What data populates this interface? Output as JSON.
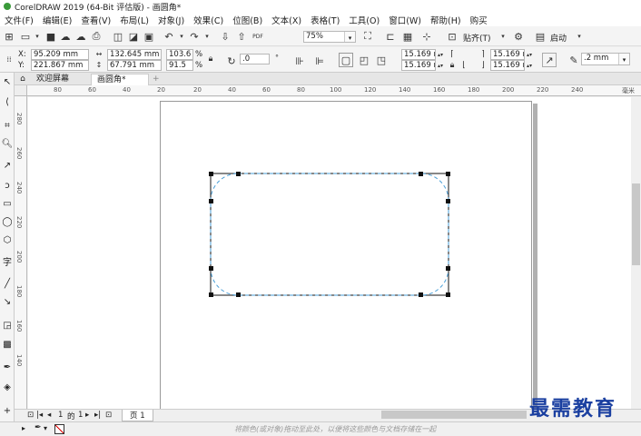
{
  "window": {
    "title": "CorelDRAW 2019 (64-Bit 评估版) - 画圆角*"
  },
  "menu": [
    "文件(F)",
    "编辑(E)",
    "查看(V)",
    "布局(L)",
    "对象(J)",
    "效果(C)",
    "位图(B)",
    "文本(X)",
    "表格(T)",
    "工具(O)",
    "窗口(W)",
    "帮助(H)",
    "购买"
  ],
  "toolbar": {
    "zoom": "75%",
    "snap_label": "贴齐(T)",
    "launch_label": "启动",
    "pdf_label": "PDF"
  },
  "propbar": {
    "x_label": "X:",
    "x_value": "95.209 mm",
    "y_label": "Y:",
    "y_value": "221.867 mm",
    "w_value": "132.645 mm",
    "h_value": "67.791 mm",
    "scale_w": "103.6",
    "scale_h": "91.5",
    "pct": "%",
    "rotation": ".0",
    "corner_tl": "15.169 mm",
    "corner_bl": "15.169 mm",
    "corner_tr": "15.169 mm",
    "corner_br": "15.169 mm",
    "outline_width": ".2 mm"
  },
  "tabs": {
    "welcome": "欢迎屏幕",
    "document": "画圆角*"
  },
  "ruler_h": [
    "80",
    "60",
    "40",
    "20",
    "0",
    "20",
    "40",
    "60",
    "80",
    "100",
    "120",
    "140",
    "160",
    "180",
    "200",
    "220",
    "240"
  ],
  "ruler_h_unit": "毫米",
  "ruler_v": [
    "280",
    "260",
    "240",
    "220",
    "200",
    "180",
    "160",
    "140"
  ],
  "pagenav": {
    "current": "1",
    "of": "的",
    "total": "1",
    "page_tab": "页 1"
  },
  "status": {
    "hint": "将颜色(或对象)拖动至此处，以便将这些颜色与文档存储在一起"
  },
  "watermark": "最需教育"
}
